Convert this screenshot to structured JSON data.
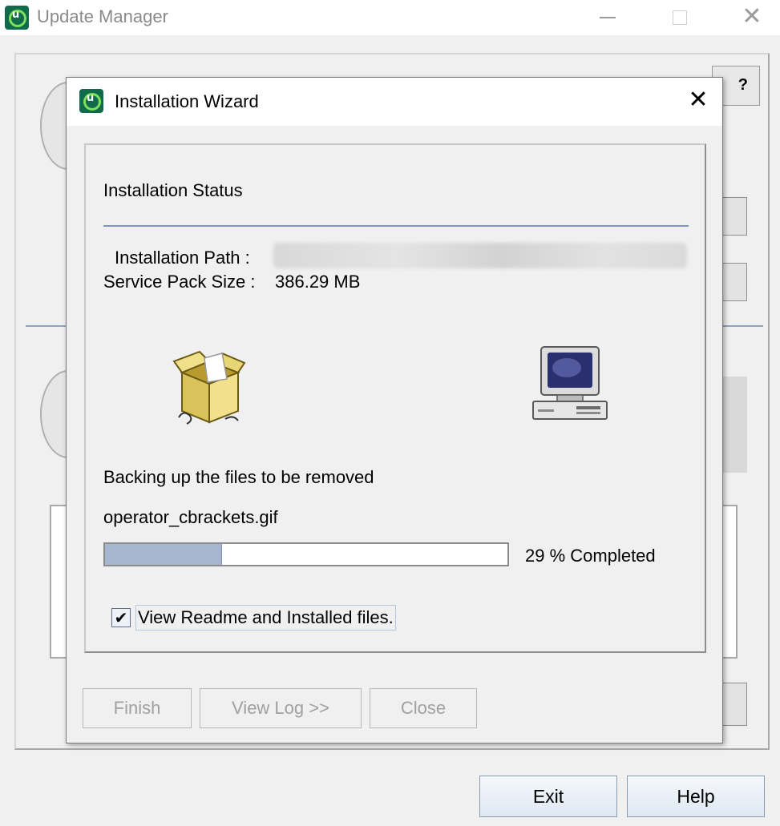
{
  "outer_window": {
    "title": "Update Manager",
    "controls": {
      "minimize": "",
      "maximize": "",
      "close": "✕"
    },
    "help_glyph": "?",
    "buttons": {
      "exit": "Exit",
      "help": "Help"
    }
  },
  "dialog": {
    "title": "Installation Wizard",
    "close_glyph": "✕",
    "section_heading": "Installation Status",
    "installation_path_label": "Installation Path :",
    "service_pack_size_label": "Service Pack Size :",
    "service_pack_size_value": "386.29 MB",
    "status_text": "Backing up the files to be removed",
    "current_file": "operator_cbrackets.gif",
    "progress": {
      "percent": 29,
      "label": "29 % Completed"
    },
    "checkbox": {
      "checked": true,
      "mark": "✔",
      "label": "View Readme and Installed files."
    },
    "buttons": {
      "finish": "Finish",
      "view_log": "View Log >>",
      "close": "Close"
    }
  },
  "colors": {
    "separator": "#7d95c2",
    "progress_fill": "#a7b7cf",
    "app_icon_bg": "#0f6b4a",
    "app_icon_ring": "#7ee05a"
  },
  "icons": [
    "app-icon",
    "package-box-icon",
    "computer-icon",
    "close-icon",
    "help-icon"
  ]
}
